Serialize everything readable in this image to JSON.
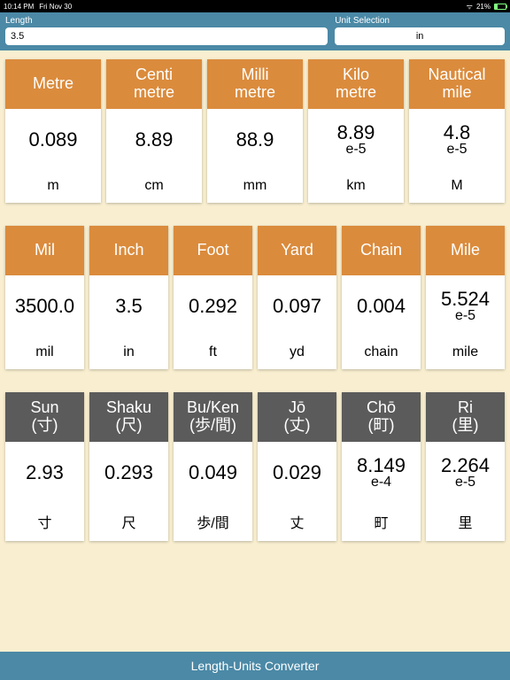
{
  "status": {
    "time": "10:14 PM",
    "date": "Fri Nov 30",
    "wifi": "•••",
    "battery_text": "21%"
  },
  "header": {
    "length_label": "Length",
    "length_value": "3.5",
    "unit_label": "Unit Selection",
    "unit_value": "in"
  },
  "rows": [
    {
      "color": "orange",
      "cards": [
        {
          "title": "Metre",
          "value": "0.089",
          "exp": "",
          "unit": "m"
        },
        {
          "title": "Centi\nmetre",
          "value": "8.89",
          "exp": "",
          "unit": "cm"
        },
        {
          "title": "Milli\nmetre",
          "value": "88.9",
          "exp": "",
          "unit": "mm"
        },
        {
          "title": "Kilo\nmetre",
          "value": "8.89",
          "exp": "e-5",
          "unit": "km"
        },
        {
          "title": "Nautical\nmile",
          "value": "4.8",
          "exp": "e-5",
          "unit": "M"
        }
      ]
    },
    {
      "color": "orange",
      "cards": [
        {
          "title": "Mil",
          "value": "3500.0",
          "exp": "",
          "unit": "mil"
        },
        {
          "title": "Inch",
          "value": "3.5",
          "exp": "",
          "unit": "in"
        },
        {
          "title": "Foot",
          "value": "0.292",
          "exp": "",
          "unit": "ft"
        },
        {
          "title": "Yard",
          "value": "0.097",
          "exp": "",
          "unit": "yd"
        },
        {
          "title": "Chain",
          "value": "0.004",
          "exp": "",
          "unit": "chain"
        },
        {
          "title": "Mile",
          "value": "5.524",
          "exp": "e-5",
          "unit": "mile"
        }
      ]
    },
    {
      "color": "gray",
      "cards": [
        {
          "title": "Sun\n(寸)",
          "value": "2.93",
          "exp": "",
          "unit": "寸"
        },
        {
          "title": "Shaku\n(尺)",
          "value": "0.293",
          "exp": "",
          "unit": "尺"
        },
        {
          "title": "Bu/Ken\n(歩/間)",
          "value": "0.049",
          "exp": "",
          "unit": "歩/間"
        },
        {
          "title": "Jō\n(丈)",
          "value": "0.029",
          "exp": "",
          "unit": "丈"
        },
        {
          "title": "Chō\n(町)",
          "value": "8.149",
          "exp": "e-4",
          "unit": "町"
        },
        {
          "title": "Ri\n(里)",
          "value": "2.264",
          "exp": "e-5",
          "unit": "里"
        }
      ]
    }
  ],
  "footer": {
    "title": "Length-Units Converter"
  }
}
